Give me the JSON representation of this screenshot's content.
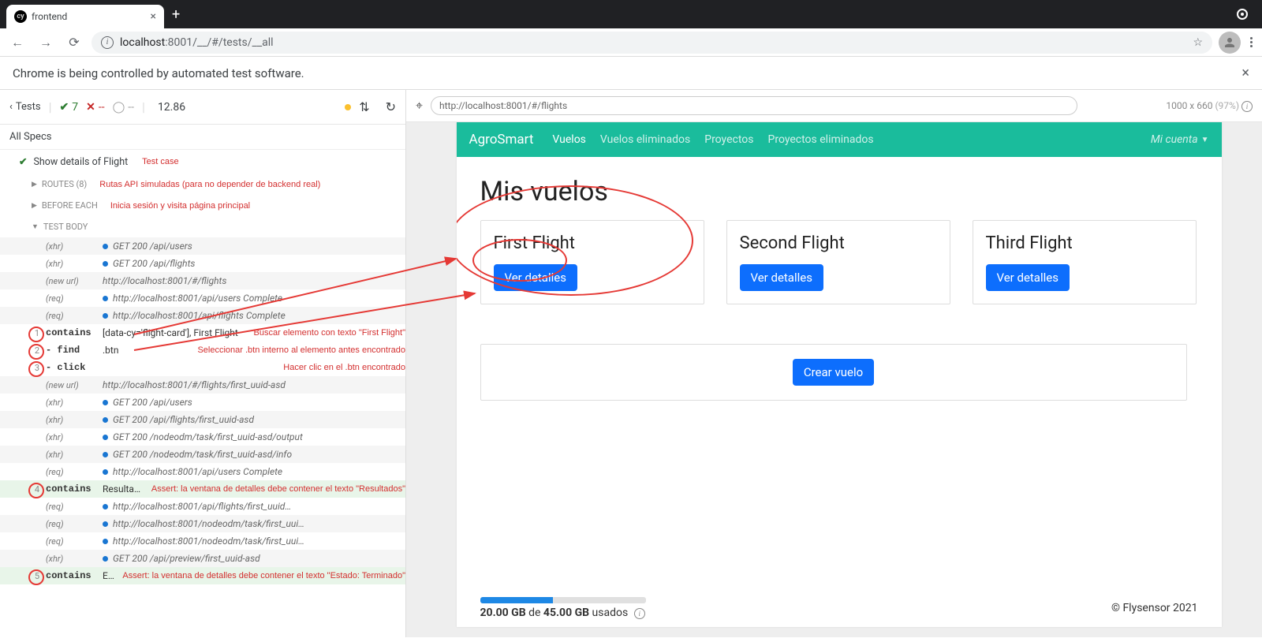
{
  "browser": {
    "tab_title": "frontend",
    "url_host": "localhost",
    "url_port": ":8001",
    "url_path": "/__/#/tests/__all"
  },
  "automation_banner": "Chrome is being controlled by automated test software.",
  "cypress": {
    "back_label": "Tests",
    "pass_count": "7",
    "fail_count": "--",
    "pend_count": "--",
    "time": "12.86",
    "all_specs": "All Specs",
    "test_title": "Show details of Flight",
    "test_case_annot": "Test case",
    "sections": {
      "routes": "ROUTES (8)",
      "routes_annot": "Rutas API simuladas (para no depender de backend real)",
      "before_each": "BEFORE EACH",
      "before_each_annot": "Inicia sesión y visita página principal",
      "test_body": "TEST BODY"
    },
    "log": [
      {
        "num": "",
        "tag": "(xhr)",
        "body": "GET 200 /api/users",
        "dot": true,
        "alt": true
      },
      {
        "num": "",
        "tag": "(xhr)",
        "body": "GET 200 /api/flights",
        "dot": true,
        "alt": false
      },
      {
        "num": "",
        "tag": "(new url)",
        "body": "http://localhost:8001/#/flights",
        "dot": false,
        "alt": true
      },
      {
        "num": "",
        "tag": "(req)",
        "body": "http://localhost:8001/api/users Complete",
        "dot": true,
        "alt": false
      },
      {
        "num": "",
        "tag": "(req)",
        "body": "http://localhost:8001/api/flights Complete",
        "dot": true,
        "alt": true
      },
      {
        "num": "1",
        "cmd": "contains",
        "body": "[data-cy='flight-card'], First Flight",
        "annot": "Buscar elemento con texto \"First Flight\""
      },
      {
        "num": "2",
        "cmd": "- find",
        "body": ".btn",
        "annot": "Seleccionar .btn interno al elemento antes encontrado"
      },
      {
        "num": "3",
        "cmd": "- click",
        "body": "",
        "annot": "Hacer clic en el .btn encontrado"
      },
      {
        "num": "",
        "tag": "(new url)",
        "body": "http://localhost:8001/#/flights/first_uuid-asd",
        "dot": false,
        "alt": true
      },
      {
        "num": "",
        "tag": "(xhr)",
        "body": "GET 200 /api/users",
        "dot": true,
        "alt": false
      },
      {
        "num": "",
        "tag": "(xhr)",
        "body": "GET 200 /api/flights/first_uuid-asd",
        "dot": true,
        "alt": true
      },
      {
        "num": "",
        "tag": "(xhr)",
        "body": "GET 200 /nodeodm/task/first_uuid-asd/output",
        "dot": true,
        "alt": false
      },
      {
        "num": "",
        "tag": "(xhr)",
        "body": "GET 200 /nodeodm/task/first_uuid-asd/info",
        "dot": true,
        "alt": true
      },
      {
        "num": "",
        "tag": "(req)",
        "body": "http://localhost:8001/api/users Complete",
        "dot": true,
        "alt": false
      },
      {
        "num": "4",
        "cmd": "contains",
        "body": "Resultados",
        "assert": true,
        "annot": "Assert: la ventana de detalles debe contener el texto \"Resultados\""
      },
      {
        "num": "",
        "tag": "(req)",
        "body": "http://localhost:8001/api/flights/first_uuid…",
        "dot": true,
        "alt": false
      },
      {
        "num": "",
        "tag": "(req)",
        "body": "http://localhost:8001/nodeodm/task/first_uui…",
        "dot": true,
        "alt": true
      },
      {
        "num": "",
        "tag": "(req)",
        "body": "http://localhost:8001/nodeodm/task/first_uui…",
        "dot": true,
        "alt": false
      },
      {
        "num": "",
        "tag": "(xhr)",
        "body": "GET 200 /api/preview/first_uuid-asd",
        "dot": true,
        "alt": true
      },
      {
        "num": "5",
        "cmd": "contains",
        "body": "Estado: Terminado",
        "assert": true,
        "annot": "Assert: la ventana de detalles debe contener el texto \"Estado: Terminado\""
      }
    ]
  },
  "preview": {
    "url": "http://localhost:8001/#/flights",
    "dims": "1000 x 660",
    "pct": "(97%)"
  },
  "app": {
    "brand": "AgroSmart",
    "nav": [
      "Vuelos",
      "Vuelos eliminados",
      "Proyectos",
      "Proyectos eliminados"
    ],
    "account": "Mi cuenta",
    "page_title": "Mis vuelos",
    "cards": [
      {
        "title": "First Flight",
        "btn": "Ver detalles"
      },
      {
        "title": "Second Flight",
        "btn": "Ver detalles"
      },
      {
        "title": "Third Flight",
        "btn": "Ver detalles"
      }
    ],
    "create_btn": "Crear vuelo",
    "storage_used": "20.00 GB",
    "storage_sep": " de ",
    "storage_total": "45.00 GB",
    "storage_suffix": " usados",
    "copyright": "© Flysensor 2021"
  }
}
